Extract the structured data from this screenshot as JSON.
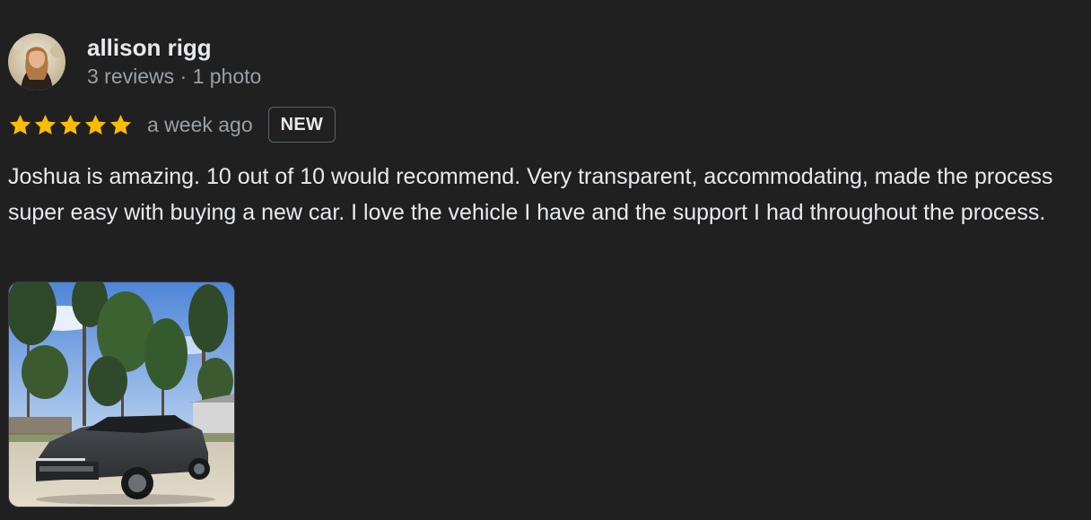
{
  "review": {
    "author_name": "allison rigg",
    "author_meta": "3 reviews · 1 photo",
    "rating": 5,
    "rating_max": 5,
    "date": "a week ago",
    "badge": "NEW",
    "text": "Joshua is amazing. 10 out of 10 would recommend. Very transparent, accommodating, made the process super easy with buying a new car. I love the vehicle I have and the support I had throughout the process.",
    "photo_count": 1
  },
  "icons": {
    "star": "star-icon",
    "avatar": "avatar"
  },
  "colors": {
    "background": "#202020",
    "text_primary": "#e8eaed",
    "text_secondary": "#9aa0a6",
    "star": "#fbbc04",
    "badge_border": "#5f6368"
  }
}
